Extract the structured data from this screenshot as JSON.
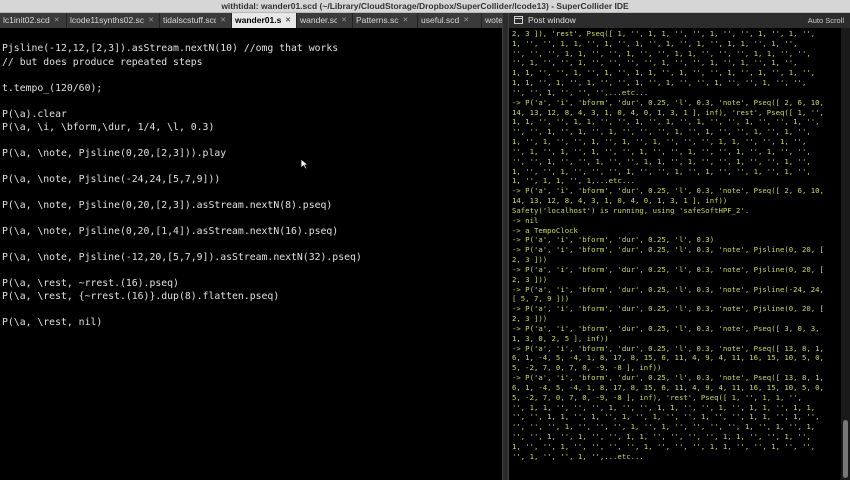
{
  "window": {
    "title": "withtidal: wander01.scd (~/Library/CloudStorage/Dropbox/SuperCollider/lcode13) - SuperCollider IDE"
  },
  "tabs": [
    {
      "label": "lc1init02.scd"
    },
    {
      "label": "lcode11synths02.scd"
    },
    {
      "label": "tidalscstuff.scd"
    },
    {
      "label": "wander01.scd"
    },
    {
      "label": "wander.sc"
    },
    {
      "label": "Patterns.sc"
    },
    {
      "label": "useful.scd"
    },
    {
      "label": "wote"
    }
  ],
  "editor": {
    "lines": [
      "Pjsline(-12,12,[2,3]).asStream.nextN(10) //omg that works",
      "// but does produce repeated steps",
      "t.tempo_(120/60);",
      "P(\\a).clear",
      "P(\\a, \\i, \\bform,\\dur, 1/4, \\l, 0.3)",
      "P(\\a, \\note, Pjsline(0,20,[2,3])).play",
      "P(\\a, \\note, Pjsline(-24,24,[5,7,9]))",
      "P(\\a, \\note, Pjsline(0,20,[2,3]).asStream.nextN(8).pseq)",
      "P(\\a, \\note, Pjsline(0,20,[1,4]).asStream.nextN(16).pseq)",
      "P(\\a, \\note, Pjsline(-12,20,[5,7,9]).asStream.nextN(32).pseq)",
      "P(\\a, \\rest, ~rrest.(16).pseq)",
      "P(\\a, \\rest, {~rrest.(16)}.dup(8).flatten.pseq)",
      "P(\\a, \\rest, nil)"
    ]
  },
  "post_window": {
    "title": "Post window",
    "auto_scroll_label": "Auto Scroll",
    "lines": [
      "2, 3 ]), 'rest', Pseq([ 1, '', 1, 1, '', '', 1, '', '', 1, '', 1, '',",
      "1, '', '', 1, 1, '', 1, '', 1, '', 1, '', 1, '', 1, 1, '', 1, '',",
      "'', '', '', 1, 1, '', '', 1, '', '', 1, 1, '', '', '', 1, 1, '', '',",
      "'', 1, '', '', 1, '', '', '', '', 1, '', '', 1, '', 1, '', 1, '',",
      "1, 1, '', '', 1, '', 1, '', 1, 1, '', 1, '', '', 1, '', 1, '', 1, '',",
      "1, 1, '', 1, '', 1, '', '', 1, '', 1, '', '', 1, '', '', 1, '', '',",
      "'', '', 1, '', '', '',...etc...",
      "-> P('a', 'i', 'bform', 'dur', 0.25, 'l', 0.3, 'note', Pseq([ 2, 6, 10,",
      "14, 13, 12, 8, 4, 3, 1, 0, 4, 0, 1, 3, 1 ], inf), 'rest', Pseq([ 1, '',",
      "1, 1, '', '', 1, 1, '', '', 1, '', 1, '', 1, '', '', 1, '', '', 1, '',",
      "'', '', 1, '', 1, '', 1, '', '', '', 1, '', 1, '', '', 1, '', 1, '',",
      "1, '', 1, '', '', 1, '', 1, '', 1, '', '', '', 1, 1, '', '', 1, '',",
      "'', 1, '', 1, '', 1, '', '', 1, '', '', 1, '', '', 1, '', 1, '', '',",
      "'', '', 1, '', '', 1, '', '', 1, 1, '', 1, '', '', 1, '', '', 1, '',",
      "1, '', '', 1, '', '', '', 1, '', '', 1, '', 1, '', '', 1, '', 1, '',",
      "1, '', 1, 1, '', 1,...etc...",
      "-> P('a', 'i', 'bform', 'dur', 0.25, 'l', 0.3, 'note', Pseq([ 2, 6, 10,",
      "14, 13, 12, 8, 4, 3, 1, 0, 4, 0, 1, 3, 1 ], inf))",
      "Safety('localhost') is running, using 'safeSoftHPF_2'.",
      "-> nil",
      "-> a TempoClock",
      "-> P('a', 'i', 'bform', 'dur', 0.25, 'l', 0.3)",
      "-> P('a', 'i', 'bform', 'dur', 0.25, 'l', 0.3, 'note', Pjsline(0, 20, [",
      "2, 3 ]))",
      "-> P('a', 'i', 'bform', 'dur', 0.25, 'l', 0.3, 'note', Pjsline(0, 20, [",
      "2, 3 ]))",
      "-> P('a', 'i', 'bform', 'dur', 0.25, 'l', 0.3, 'note', Pjsline(-24, 24,",
      "[ 5, 7, 9 ]))",
      "-> P('a', 'i', 'bform', 'dur', 0.25, 'l', 0.3, 'note', Pjsline(0, 20, [",
      "2, 3 ]))",
      "-> P('a', 'i', 'bform', 'dur', 0.25, 'l', 0.3, 'note', Pseq([ 3, 0, 3,",
      "1, 3, 0, 2, 5 ], inf))",
      "-> P('a', 'i', 'bform', 'dur', 0.25, 'l', 0.3, 'note', Pseq([ 13, 8, 1,",
      "6, 1, -4, 5, -4, 1, 8, 17, 8, 15, 6, 11, 4, 9, 4, 11, 16, 15, 10, 5, 0,",
      "5, -2, 7, 0, 7, 0, -9, -8 ], inf))",
      "-> P('a', 'i', 'bform', 'dur', 0.25, 'l', 0.3, 'note', Pseq([ 13, 8, 1,",
      "6, 1, -4, 5, -4, 1, 8, 17, 8, 15, 6, 11, 4, 9, 4, 11, 16, 15, 10, 5, 0,",
      "5, -2, 7, 0, 7, 0, -9, -8 ], inf), 'rest', Pseq([ 1, '', 1, 1, '',",
      "'', 1, 1, '', '', '', 1, '', '', 1, 1, '', '', 1, '', 1, 1, '', 1, 1,",
      "'', '', 1, 1, '', 1, '', 1, '', 1, '', '', 1, '', '', 1, 1, '', 1, '',",
      "'', '', '', 1, '', '', '', 1, '', 1, '', '', '', '', 1, '', 1, '', 1,",
      "'', '', 1, '', 1, '', '', 1, 1, '', '', '', '', 1, 1, '', '', 1, '',",
      "1, '', '', 1, '', '', '', '', 1, '', '', '', 1, 1, '', '', 1, '', '',",
      "'', 1, '', '', 1, '',...etc..."
    ]
  },
  "colors": {
    "post_text": "#c5dd62",
    "editor_text": "#e0e0e0",
    "background": "#000000"
  }
}
